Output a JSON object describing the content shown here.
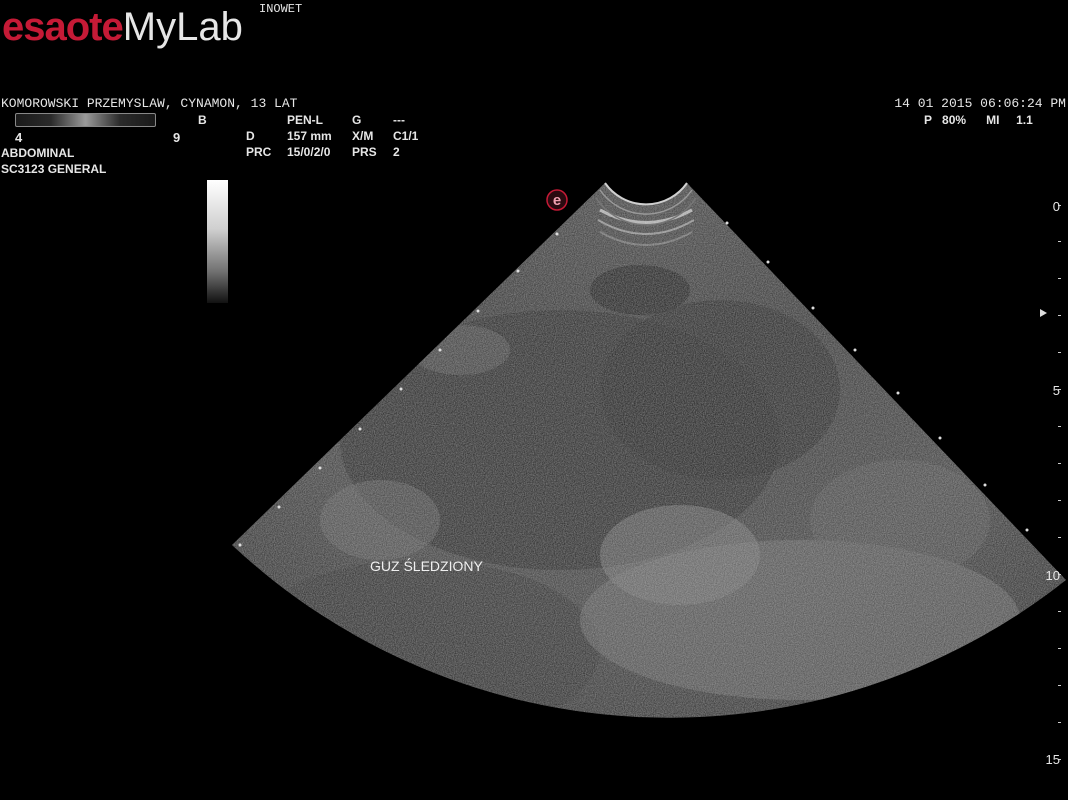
{
  "header": {
    "brand": "esaote",
    "product": "MyLab",
    "clinic": "INOWET",
    "patient_line": "KOMOROWSKI PRZEMYSLAW, CYNAMON, 13 LAT",
    "date_time": "14  01  2015 06:06:24 PM",
    "power_label": "P",
    "power_value": "80%",
    "mi_label": "MI",
    "mi_value": "1.1"
  },
  "gain": {
    "min": "4",
    "max": "9"
  },
  "params": {
    "mode": "B",
    "probe": "PEN-L",
    "g_label": "G",
    "g_value": "---",
    "d_label": "D",
    "d_value": "157 mm",
    "xm_label": "X/M",
    "xm_value": "C1/1",
    "prc_label": "PRC",
    "prc_value": "15/0/2/0",
    "prs_label": "PRS",
    "prs_value": "2"
  },
  "preset": {
    "exam": "ABDOMINAL",
    "probe_preset": "SC3123  GENERAL"
  },
  "depth_scale": [
    "0",
    "5",
    "10",
    "15"
  ],
  "annotation": "GUZ ŚLEDZIONY",
  "colors": {
    "brand_red": "#c51a36",
    "background": "#000000",
    "text": "#e6e6e6"
  }
}
